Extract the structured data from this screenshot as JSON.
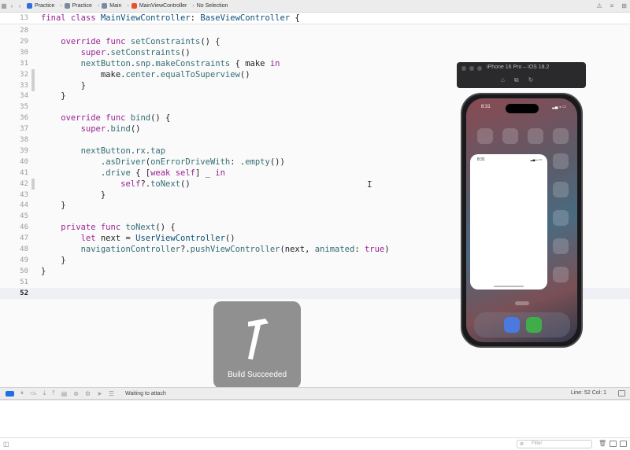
{
  "breadcrumb": {
    "project": "Practice",
    "folder": "Practice",
    "group": "Main",
    "file": "MainViewController",
    "selection": "No Selection"
  },
  "sticky_header": {
    "line_number": "13",
    "tokens": [
      {
        "t": "final class ",
        "c": "kw"
      },
      {
        "t": "MainViewController",
        "c": "ty"
      },
      {
        "t": ": ",
        "c": ""
      },
      {
        "t": "BaseViewController",
        "c": "ty"
      },
      {
        "t": " {",
        "c": ""
      }
    ]
  },
  "code_lines": [
    {
      "n": "28",
      "fold": "",
      "tokens": []
    },
    {
      "n": "29",
      "fold": "",
      "tokens": [
        {
          "t": "    override func ",
          "c": "kw"
        },
        {
          "t": "setConstraints",
          "c": "fn"
        },
        {
          "t": "() {",
          "c": ""
        }
      ]
    },
    {
      "n": "30",
      "fold": "",
      "tokens": [
        {
          "t": "        super",
          "c": "kw"
        },
        {
          "t": ".",
          "c": ""
        },
        {
          "t": "setConstraints",
          "c": "fn"
        },
        {
          "t": "()",
          "c": ""
        }
      ]
    },
    {
      "n": "31",
      "fold": "",
      "tokens": [
        {
          "t": "        nextButton",
          "c": "fn"
        },
        {
          "t": ".",
          "c": ""
        },
        {
          "t": "snp",
          "c": "fn"
        },
        {
          "t": ".",
          "c": ""
        },
        {
          "t": "makeConstraints",
          "c": "fn"
        },
        {
          "t": " { make ",
          "c": ""
        },
        {
          "t": "in",
          "c": "kw"
        }
      ]
    },
    {
      "n": "32",
      "fold": "dark",
      "tokens": [
        {
          "t": "            make",
          "c": ""
        },
        {
          "t": ".",
          "c": ""
        },
        {
          "t": "center",
          "c": "fn"
        },
        {
          "t": ".",
          "c": ""
        },
        {
          "t": "equalToSuperview",
          "c": "fn"
        },
        {
          "t": "()",
          "c": ""
        }
      ]
    },
    {
      "n": "33",
      "fold": "dark",
      "tokens": [
        {
          "t": "        }",
          "c": ""
        }
      ]
    },
    {
      "n": "34",
      "fold": "",
      "tokens": [
        {
          "t": "    }",
          "c": ""
        }
      ]
    },
    {
      "n": "35",
      "fold": "",
      "tokens": []
    },
    {
      "n": "36",
      "fold": "",
      "tokens": [
        {
          "t": "    override func ",
          "c": "kw"
        },
        {
          "t": "bind",
          "c": "fn"
        },
        {
          "t": "() {",
          "c": ""
        }
      ]
    },
    {
      "n": "37",
      "fold": "",
      "tokens": [
        {
          "t": "        super",
          "c": "kw"
        },
        {
          "t": ".",
          "c": ""
        },
        {
          "t": "bind",
          "c": "fn"
        },
        {
          "t": "()",
          "c": ""
        }
      ]
    },
    {
      "n": "38",
      "fold": "",
      "tokens": []
    },
    {
      "n": "39",
      "fold": "",
      "tokens": [
        {
          "t": "        nextButton",
          "c": "fn"
        },
        {
          "t": ".",
          "c": ""
        },
        {
          "t": "rx",
          "c": "fn"
        },
        {
          "t": ".",
          "c": ""
        },
        {
          "t": "tap",
          "c": "fn"
        }
      ]
    },
    {
      "n": "40",
      "fold": "",
      "tokens": [
        {
          "t": "            .",
          "c": ""
        },
        {
          "t": "asDriver",
          "c": "fn"
        },
        {
          "t": "(",
          "c": ""
        },
        {
          "t": "onErrorDriveWith",
          "c": "fn"
        },
        {
          "t": ": .",
          "c": ""
        },
        {
          "t": "empty",
          "c": "fn"
        },
        {
          "t": "())",
          "c": ""
        }
      ]
    },
    {
      "n": "41",
      "fold": "",
      "tokens": [
        {
          "t": "            .",
          "c": ""
        },
        {
          "t": "drive",
          "c": "fn"
        },
        {
          "t": " { [",
          "c": ""
        },
        {
          "t": "weak self",
          "c": "kw"
        },
        {
          "t": "] _ ",
          "c": ""
        },
        {
          "t": "in",
          "c": "kw"
        }
      ]
    },
    {
      "n": "42",
      "fold": "dark",
      "tokens": [
        {
          "t": "                self",
          "c": "kw"
        },
        {
          "t": "?.",
          "c": ""
        },
        {
          "t": "toNext",
          "c": "fn"
        },
        {
          "t": "()",
          "c": ""
        }
      ]
    },
    {
      "n": "43",
      "fold": "",
      "tokens": [
        {
          "t": "            }",
          "c": ""
        }
      ]
    },
    {
      "n": "44",
      "fold": "",
      "tokens": [
        {
          "t": "    }",
          "c": ""
        }
      ]
    },
    {
      "n": "45",
      "fold": "",
      "tokens": []
    },
    {
      "n": "46",
      "fold": "",
      "tokens": [
        {
          "t": "    private func ",
          "c": "kw"
        },
        {
          "t": "toNext",
          "c": "fn"
        },
        {
          "t": "() {",
          "c": ""
        }
      ]
    },
    {
      "n": "47",
      "fold": "",
      "tokens": [
        {
          "t": "        let ",
          "c": "kw"
        },
        {
          "t": "next = ",
          "c": ""
        },
        {
          "t": "UserViewController",
          "c": "ty"
        },
        {
          "t": "()",
          "c": ""
        }
      ]
    },
    {
      "n": "48",
      "fold": "",
      "tokens": [
        {
          "t": "        navigationController",
          "c": "fn"
        },
        {
          "t": "?.",
          "c": ""
        },
        {
          "t": "pushViewController",
          "c": "fn"
        },
        {
          "t": "(next, ",
          "c": ""
        },
        {
          "t": "animated",
          "c": "fn"
        },
        {
          "t": ": ",
          "c": ""
        },
        {
          "t": "true",
          "c": "kw"
        },
        {
          "t": ")",
          "c": ""
        }
      ]
    },
    {
      "n": "49",
      "fold": "",
      "tokens": [
        {
          "t": "    }",
          "c": ""
        }
      ]
    },
    {
      "n": "50",
      "fold": "",
      "tokens": [
        {
          "t": "}",
          "c": ""
        }
      ]
    },
    {
      "n": "51",
      "fold": "",
      "tokens": []
    },
    {
      "n": "52",
      "fold": "",
      "tokens": [],
      "current": true
    }
  ],
  "simulator": {
    "title": "iPhone 16 Pro – iOS 18.2",
    "status_time": "8:31",
    "sheet_time": "8:31"
  },
  "build_hud": {
    "label": "Build Succeeded",
    "icon": "hammer-icon"
  },
  "debug_bar": {
    "status": "Waiting to attach",
    "position": "Line: 52  Col: 1"
  },
  "console": {
    "filter_placeholder": "Filter"
  },
  "colors": {
    "keyword": "#9b2393",
    "type": "#0b4f79",
    "function": "#326d74",
    "accent": "#1e6ee6"
  }
}
